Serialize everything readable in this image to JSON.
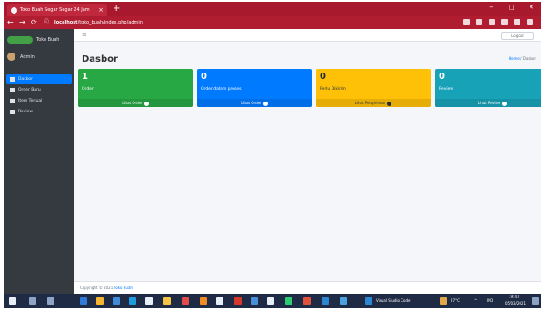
{
  "browser": {
    "tab_title": "Toko Buah Segar Segar 24 Jam",
    "new_tab": "+",
    "url_host": "localhost",
    "url_path": "/toko_buah/index.php/admin",
    "window_controls": [
      "−",
      "□",
      "✕"
    ]
  },
  "sidebar": {
    "brand": "Toko Buah",
    "user": "Admin",
    "items": [
      {
        "label": "Dasbor",
        "active": true
      },
      {
        "label": "Order Baru",
        "active": false
      },
      {
        "label": "Item Terjual",
        "active": false
      },
      {
        "label": "Review",
        "active": false
      }
    ]
  },
  "topnav": {
    "logout": "Logout"
  },
  "page": {
    "title": "Dasbor",
    "breadcrumb": {
      "home": "Home",
      "current": "Dasbor"
    }
  },
  "boxes": [
    {
      "value": "1",
      "label": "Order",
      "footer": "Lihat Order",
      "color": "#28a745"
    },
    {
      "value": "0",
      "label": "Order dalam proses",
      "footer": "Lihat Order",
      "color": "#007bff"
    },
    {
      "value": "0",
      "label": "Perlu Dikirim",
      "footer": "Lihat Pengiriman",
      "color": "#ffc107"
    },
    {
      "value": "0",
      "label": "Review",
      "footer": "Lihat Review",
      "color": "#17a2b8"
    }
  ],
  "footer": {
    "copyright": "Copyright © 2021",
    "site": "Toko Buah"
  },
  "taskbar": {
    "app_label": "Visual Studio Code",
    "weather": "27°C",
    "lang": "IND",
    "time": "19:47",
    "date": "05/03/2021"
  }
}
